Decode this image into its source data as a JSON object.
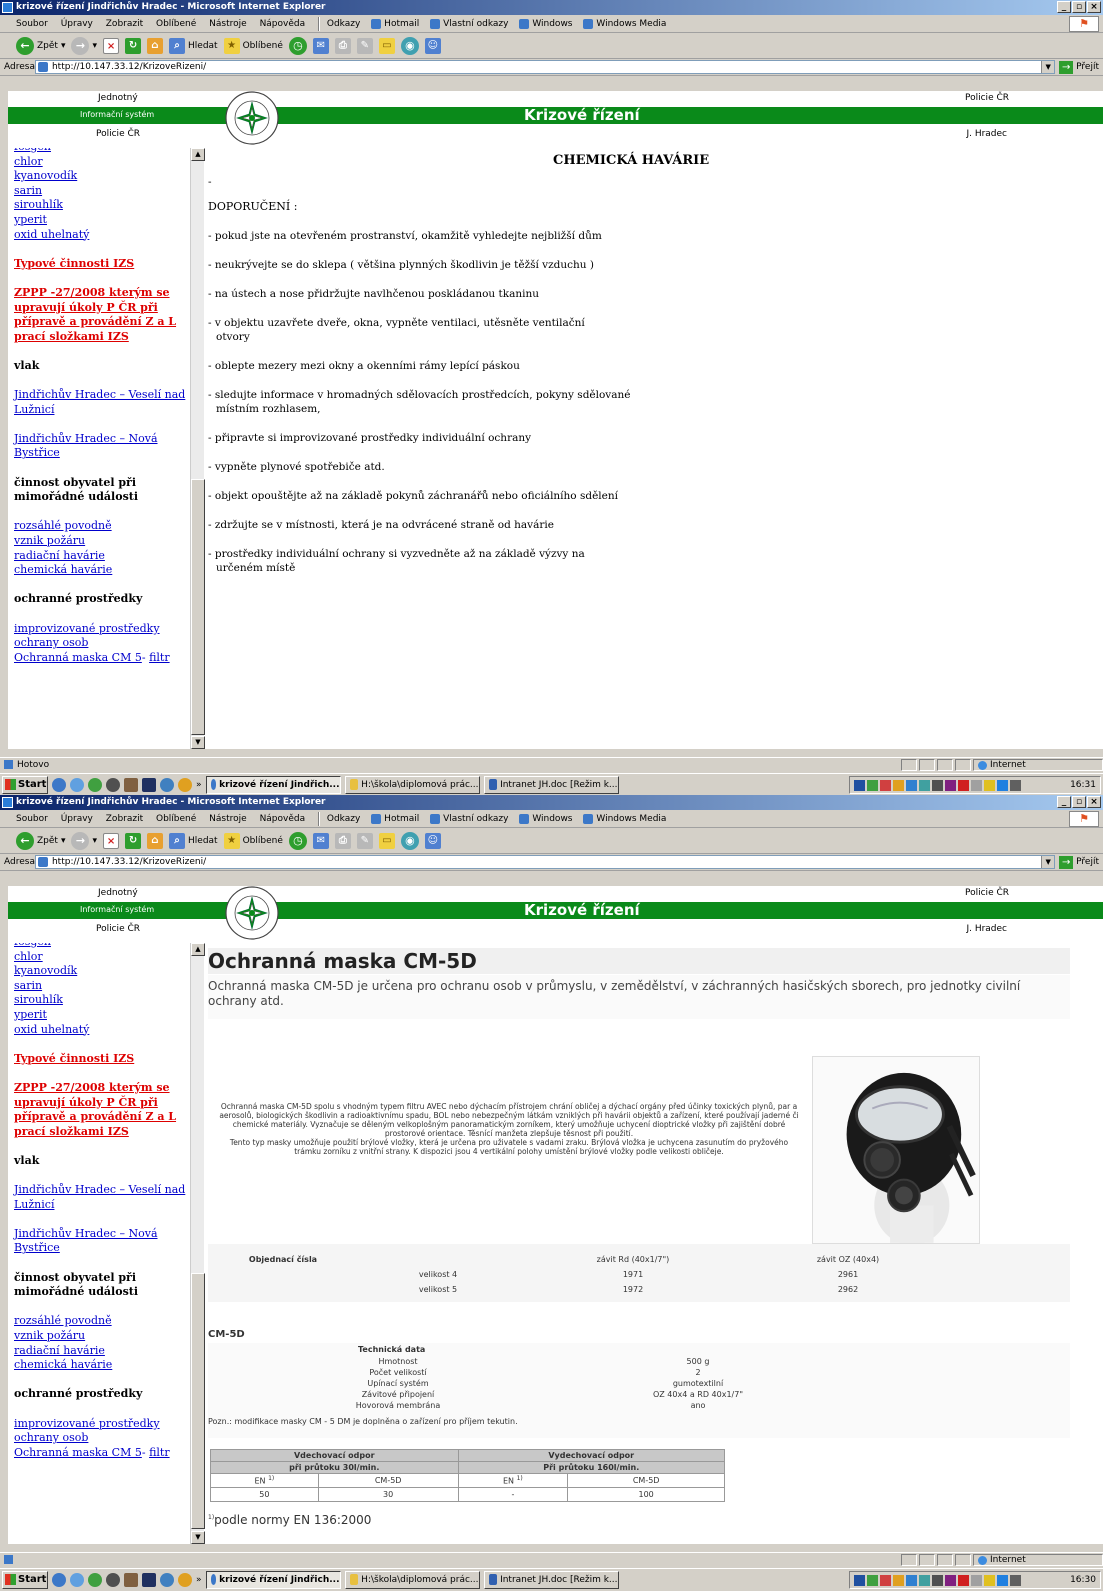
{
  "window": {
    "title": "krizové řízení Jindřichův Hradec - Microsoft Internet Explorer",
    "minimize": "_",
    "restore": "▫",
    "close": "×"
  },
  "menu": {
    "items": [
      "Soubor",
      "Úpravy",
      "Zobrazit",
      "Oblíbené",
      "Nástroje",
      "Nápověda"
    ],
    "links_label": "Odkazy",
    "links": [
      "Hotmail",
      "Vlastní odkazy",
      "Windows",
      "Windows Media"
    ]
  },
  "toolbar": {
    "back": "Zpět",
    "search": "Hledat",
    "favorites": "Oblíbené"
  },
  "address": {
    "label": "Adresa",
    "url": "http://10.147.33.12/KrizoveRizeni/",
    "go": "Přejít"
  },
  "banner": {
    "top_left": "Jednotný",
    "subtitle": "Informační systém",
    "bottom_left": "Policie ČR",
    "title": "Krizové řízení",
    "top_right": "Policie ČR",
    "bottom_right": "J. Hradec",
    "badge_text": "POLICIE ČESKÉ REPUBLIKY"
  },
  "sidebar": {
    "cut_item": "fosgen",
    "chemicals": [
      "chlor",
      "kyanovodík",
      "sarin",
      "sirouhlík",
      "yperit",
      "oxid uhelnatý"
    ],
    "izs_link": "Typové činnosti IZS",
    "zppp_link": [
      "ZPPP -27/2008 kterým se",
      "upravují úkoly P ČR při",
      "přípravě a provádění Z a L",
      "prací složkami IZS"
    ],
    "train_heading": "vlak",
    "train_links": [
      [
        "Jindřichův Hradec – Veselí nad",
        "Lužnicí"
      ],
      [
        "Jindřichův Hradec – Nová",
        "Bystřice"
      ]
    ],
    "activity_heading": [
      "činnost obyvatel při",
      "mimořádné události"
    ],
    "activity_links": [
      "rozsáhlé povodně",
      "vznik požáru",
      "radiační havárie",
      "chemická havárie"
    ],
    "protection_heading": "ochranné prostředky",
    "protection_links": [
      [
        "improvizované prostředky",
        "ochrany osob"
      ]
    ],
    "mask_link": "Ochranná maska CM 5",
    "mask_dash": "- ",
    "filter_link": "filtr"
  },
  "chemical": {
    "heading": "CHEMICKÁ  HAVÁRIE",
    "dash": "-",
    "recommend": "DOPORUČENÍ :",
    "items": [
      [
        "- pokud jste na otevřeném prostranství, okamžitě vyhledejte nejbližší dům"
      ],
      [
        "- neukrývejte se do sklepa ( většina plynných škodlivin je těžší vzduchu )"
      ],
      [
        "- na ústech a nose přidržujte navlhčenou poskládanou tkaninu"
      ],
      [
        "- v  objektu  uzavřete  dveře, okna, vypněte  ventilaci,  utěsněte  ventilační",
        "otvory"
      ],
      [
        "- oblepte mezery mezi okny a okenními rámy lepící páskou"
      ],
      [
        "- sledujte informace v hromadných sdělovacích prostředcích, pokyny sdělované",
        "místním rozhlasem,"
      ],
      [
        "- připravte si improvizované prostředky individuální ochrany"
      ],
      [
        "- vypněte plynové spotřebiče atd."
      ],
      [
        "- objekt opouštějte až na základě pokynů záchranářů nebo oficiálního sdělení"
      ],
      [
        "- zdržujte se v místnosti, která je na odvrácené straně od havárie"
      ],
      [
        "- prostředky individuální ochrany si vyzvedněte až na základě výzvy na",
        "určeném místě"
      ]
    ]
  },
  "mask": {
    "title": "Ochranná maska CM-5D",
    "intro": "Ochranná maska CM-5D je určena pro ochranu osob v průmyslu, v zemědělství, v záchranných hasičských sborech, pro jednotky civilní ochrany atd.",
    "description": "Ochranná maska CM-5D spolu s vhodným typem filtru AVEC nebo dýchacím přístrojem chrání obličej a dýchací orgány před účinky toxických plynů, par a aerosolů, biologických škodlivin a radioaktivnímu spadu, BOL nebo nebezpečným látkám vzniklých při havárii objektů a zařízení, které používají jaderné či chemické materiály. Vyznačuje se děleným velkoplošným panoramatickým zorníkem, který umožňuje uchycení dioptrické vložky při zajištění dobré prostorové orientace. Těsnící manžeta zlepšuje těsnost při použití.",
    "description2": "Tento typ masky umožňuje použití brýlové vložky, která je určena pro uživatele s vadami zraku. Brýlová vložka je uchycena zasunutím do pryžového trámku zorníku z vnitřní strany. K dispozici jsou 4 vertikální polohy umístění brýlové vložky podle velikosti obličeje.",
    "order": {
      "header": [
        "Objednací čísla",
        "",
        "závit Rd (40x1/7\")",
        "závit OZ (40x4)"
      ],
      "rows": [
        [
          "",
          "velikost 4",
          "1971",
          "2961"
        ],
        [
          "",
          "velikost 5",
          "1972",
          "2962"
        ]
      ]
    },
    "model": "CM-5D",
    "tech": {
      "heading": "Technická data",
      "rows": [
        [
          "Hmotnost",
          "500 g"
        ],
        [
          "Počet velikostí",
          "2"
        ],
        [
          "Upínací systém",
          "gumotextilní"
        ],
        [
          "Závitové připojení",
          "OZ 40x4  a  RD 40x1/7\""
        ],
        [
          "Hovorová membrána",
          "ano"
        ]
      ],
      "note": "Pozn.: modifikace masky CM - 5 DM je doplněna o zařízení pro příjem tekutin."
    },
    "resist": {
      "in_title": "Vdechovací odpor",
      "in_sub": "při průtoku 30l/min.",
      "out_title": "Vydechovací odpor",
      "out_sub": "Při průtoku 160l/min.",
      "cols": [
        "EN ",
        "CM-5D",
        "EN ",
        "CM-5D"
      ],
      "sup": "1)",
      "values": [
        "50",
        "30",
        "-",
        "100"
      ]
    },
    "footnote_sup": "1)",
    "footnote": "podle normy EN 136:2000"
  },
  "status": {
    "done": "Hotovo",
    "zone": "Internet"
  },
  "taskbar": {
    "start": "Start",
    "chevron": "»",
    "tasks": [
      "krizové řízení Jindřich...",
      "H:\\škola\\diplomová prác...",
      "Intranet JH.doc [Režim k..."
    ],
    "clock1": "16:31",
    "clock2": "16:30"
  },
  "colors": {
    "banner_green": "#0a8a1a",
    "link": "#0000cc",
    "red_link": "#dd0000"
  }
}
